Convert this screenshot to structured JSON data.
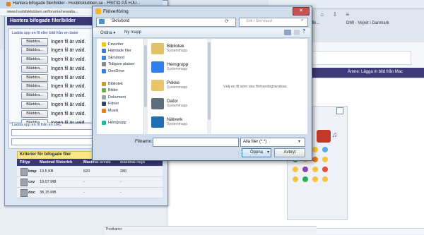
{
  "browser": {
    "tab_traffic": "- trafiken - Trafik...",
    "tab_dmi": "DMI - Vejret i Danmark",
    "amne": "Ämne: Lägga in bild från Mac",
    "postkaner": "Postkaner"
  },
  "popup": {
    "title": "Hantera bifogade filer/bilder - Husbilsklubben.se - FRITID PÅ HJU...",
    "url": "www.husbilsklubben.se/forums/newatta...",
    "header": "Hantera bifogade filer/bilder",
    "upload_legend": "Ladda upp en fil eller bild från en dator",
    "browse_label": "Bläddra...",
    "nofile_label": "Ingen fil är vald.",
    "upload_rows": 10,
    "url_legend": "Ladda upp en fil från en URL",
    "criteria_title": "Kriterier för bifogade filer",
    "table_headers": [
      "Filtyp",
      "Maximal filstorlek",
      "Maximal bredd",
      "Maximal höjd"
    ],
    "table_rows": [
      {
        "type": "bmp",
        "size": "19,5 KB",
        "width": "620",
        "height": "280"
      },
      {
        "type": "csv",
        "size": "19,07 MB",
        "width": "-",
        "height": "-"
      },
      {
        "type": "doc",
        "size": "38,15 MB",
        "width": "-",
        "height": "-"
      }
    ]
  },
  "dialog": {
    "title": "Filöverföring",
    "close": "✕",
    "address": "Skrivbord",
    "search_placeholder": "Sök i Skrivbord",
    "organize": "Ordna ▾",
    "new_folder": "Ny mapp",
    "nav_favorites": [
      {
        "label": "Favoriter",
        "icon": "star-icon"
      },
      {
        "label": "Hämtade filer",
        "icon": "download-folder-icon"
      },
      {
        "label": "Skrivbord",
        "icon": "desktop-icon"
      },
      {
        "label": "Tidigare platser",
        "icon": "recent-places-icon"
      },
      {
        "label": "OneDrive",
        "icon": "cloud-icon"
      }
    ],
    "nav_libraries": [
      {
        "label": "Bibliotek",
        "icon": "library-icon"
      },
      {
        "label": "Bilder",
        "icon": "pictures-icon"
      },
      {
        "label": "Dokument",
        "icon": "documents-icon"
      },
      {
        "label": "Filmer",
        "icon": "videos-icon"
      },
      {
        "label": "Musik",
        "icon": "music-icon"
      }
    ],
    "nav_homegroup": {
      "label": "Hemgrupp",
      "icon": "homegroup-icon"
    },
    "files": [
      {
        "name": "Bibliotek",
        "sub": "Systemmapp",
        "icon": "library-folder-icon"
      },
      {
        "name": "Hemgrupp",
        "sub": "Systemmapp",
        "icon": "homegroup-globe-icon"
      },
      {
        "name": "Pekke",
        "sub": "Systemmapp",
        "icon": "user-folder-icon"
      },
      {
        "name": "Dator",
        "sub": "Systemmapp",
        "icon": "computer-icon"
      },
      {
        "name": "Nätverk",
        "sub": "Systemmapp",
        "icon": "network-icon"
      }
    ],
    "preview_text": "Välj en fil som ska förhandsgranskas.",
    "filename_label": "Filnamn:",
    "filename_value": "",
    "filter_label": "Alla filer (*.*)",
    "open_label": "Öppna",
    "cancel_label": "Avbryt"
  }
}
